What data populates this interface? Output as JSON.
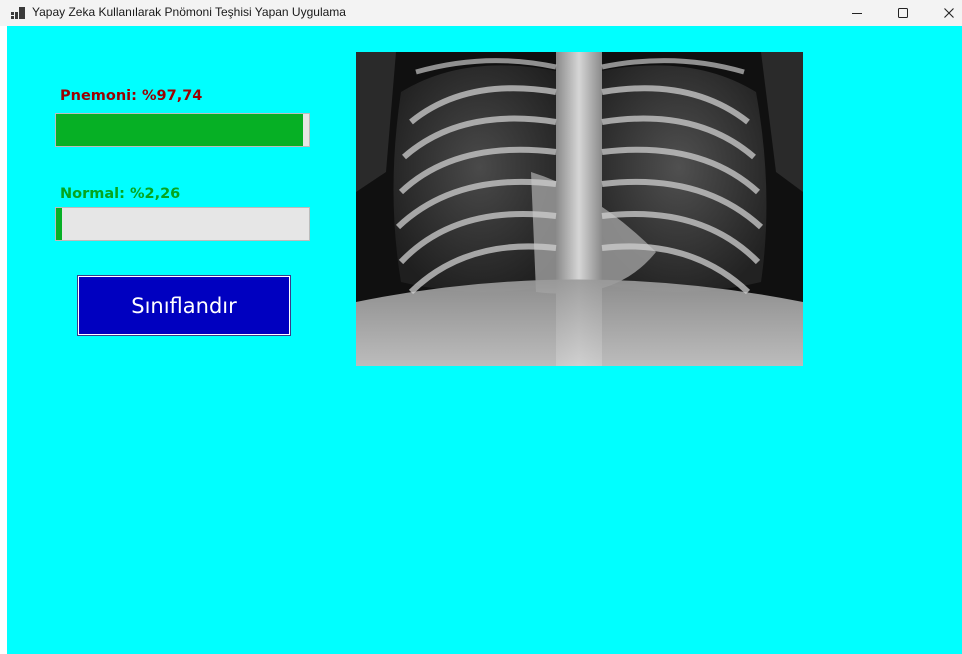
{
  "window": {
    "title": "Yapay Zeka Kullanılarak Pnömoni Teşhisi Yapan Uygulama",
    "controls": [
      "minimize-icon",
      "maximize-icon",
      "close-icon"
    ]
  },
  "colors": {
    "background": "#00ffff",
    "pneumonia_label": "#9b0000",
    "normal_label": "#05a51e",
    "progress_fill": "#06b025",
    "button_bg": "#0000c0",
    "button_text": "#ffffff"
  },
  "results": {
    "pneumonia": {
      "label": "Pnemoni: %97,74",
      "value": 97.74
    },
    "normal": {
      "label": "Normal: %2,26",
      "value": 2.26
    }
  },
  "classify_button": {
    "label": "Sınıflandır"
  },
  "image": {
    "content": "chest-xray"
  }
}
